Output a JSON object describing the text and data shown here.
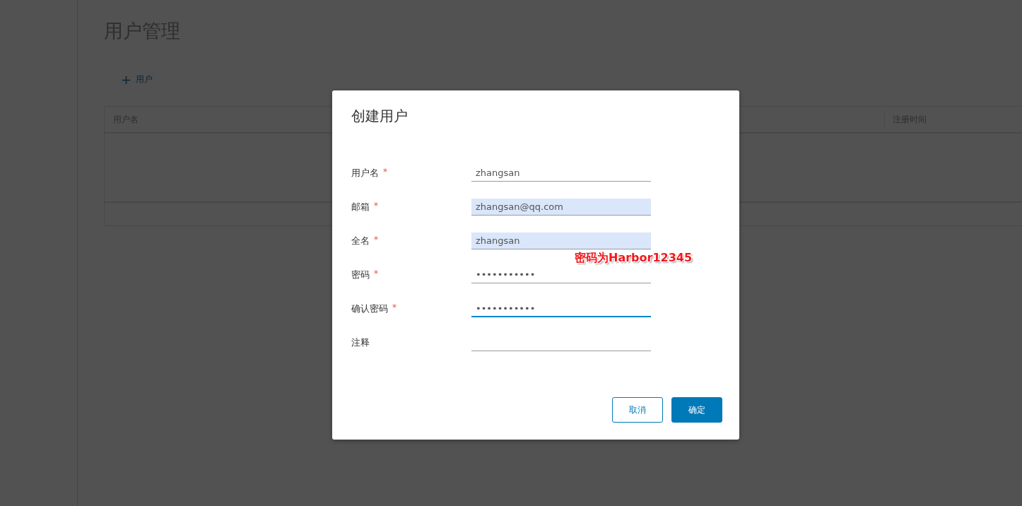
{
  "page": {
    "title": "用户管理",
    "add_button": {
      "icon": "+",
      "label": "用户"
    },
    "table": {
      "columns": [
        {
          "label": "用户名"
        },
        {
          "label": "注册时间"
        }
      ]
    }
  },
  "dialog": {
    "title": "创建用户",
    "fields": [
      {
        "label": "用户名",
        "required": true,
        "value": "zhangsan",
        "autofilled": false,
        "focused": false
      },
      {
        "label": "邮箱",
        "required": true,
        "value": "zhangsan@qq.com",
        "autofilled": true,
        "focused": false
      },
      {
        "label": "全名",
        "required": true,
        "value": "zhangsan",
        "autofilled": true,
        "focused": false
      },
      {
        "label": "密码",
        "required": true,
        "value": "•••••••••••",
        "autofilled": false,
        "focused": false,
        "annotation": "密码为Harbor12345"
      },
      {
        "label": "确认密码",
        "required": true,
        "value": "•••••••••••",
        "autofilled": false,
        "focused": true
      },
      {
        "label": "注释",
        "required": false,
        "autofilled": false,
        "focused": false
      }
    ],
    "required_mark": "*",
    "buttons": [
      {
        "label": "取消",
        "kind": "secondary"
      },
      {
        "label": "确定",
        "kind": "primary"
      }
    ]
  }
}
